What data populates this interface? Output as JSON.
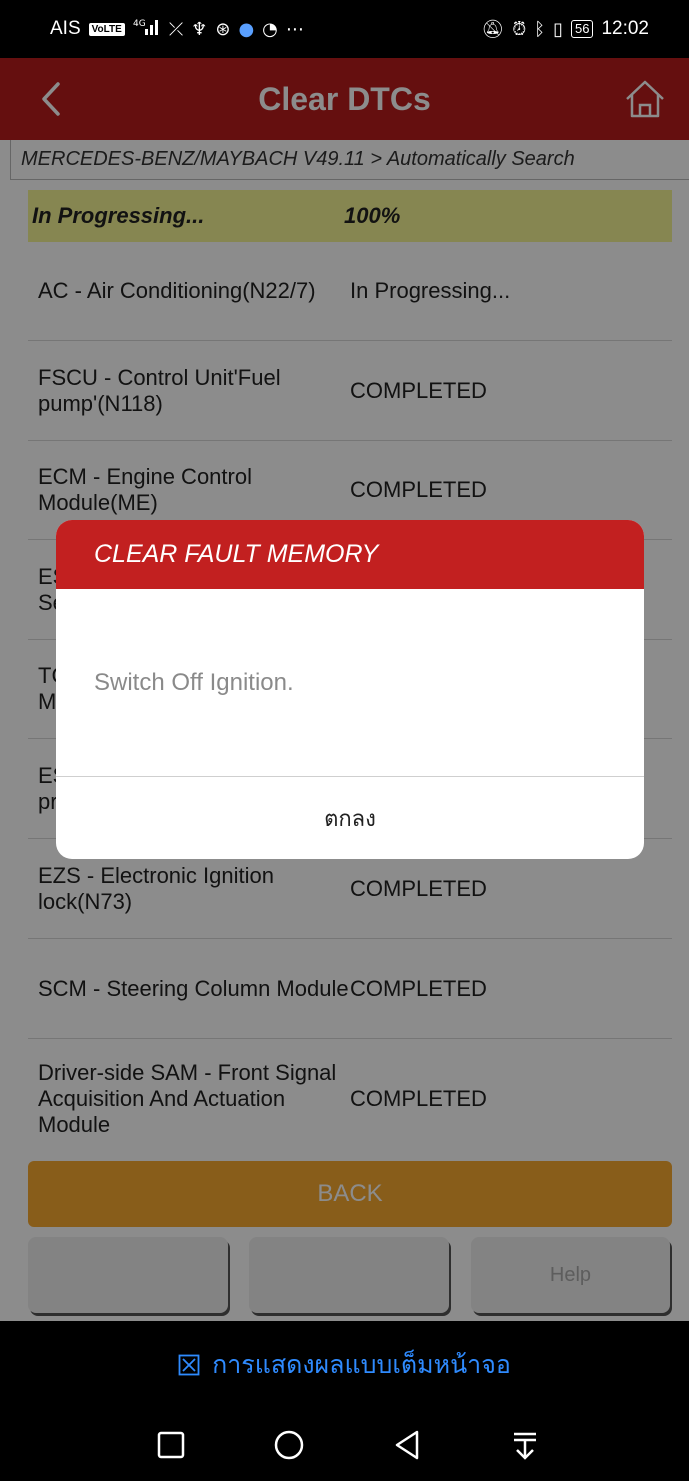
{
  "status_bar": {
    "carrier": "AIS",
    "volte": "VoLTE",
    "network": "4G",
    "battery": "56",
    "time": "12:02"
  },
  "header": {
    "title": "Clear DTCs"
  },
  "breadcrumb": "MERCEDES-BENZ/MAYBACH V49.11 > Automatically Search",
  "progress": {
    "label": "In Progressing...",
    "percent_text": "100%"
  },
  "modules": [
    {
      "name": "AC - Air Conditioning(N22/7)",
      "status": "In Progressing..."
    },
    {
      "name": "FSCU - Control Unit'Fuel pump'(N118)",
      "status": "COMPLETED"
    },
    {
      "name": "ECM - Engine Control Module(ME)",
      "status": "COMPLETED"
    },
    {
      "name": "ES Se",
      "status": ""
    },
    {
      "name": "TC M",
      "status": ""
    },
    {
      "name": "ES pr",
      "status": ""
    },
    {
      "name": "EZS - Electronic Ignition lock(N73)",
      "status": "COMPLETED"
    },
    {
      "name": "SCM - Steering Column Module",
      "status": "COMPLETED"
    },
    {
      "name": "Driver-side SAM - Front Signal Acquisition And Actuation Module",
      "status": "COMPLETED"
    }
  ],
  "buttons": {
    "back": "BACK",
    "func1": "",
    "func2": "",
    "help": "Help"
  },
  "dialog": {
    "title": "CLEAR FAULT MEMORY",
    "message": "Switch Off Ignition.",
    "ok": "ตกลง"
  },
  "fullscreen_bar": {
    "label": "การแสดงผลแบบเต็มหน้าจอ"
  },
  "colors": {
    "header_red": "#b81c1c",
    "dialog_red": "#c22020",
    "progress_yellow": "#f5f594",
    "back_orange": "#f7a930",
    "link_blue": "#2f8bff"
  }
}
